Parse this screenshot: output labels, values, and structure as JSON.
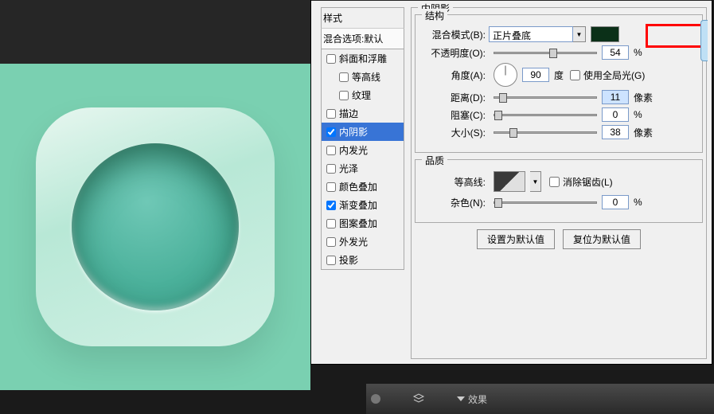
{
  "styles_panel": {
    "header": "样式",
    "default_row": "混合选项:默认",
    "items": [
      {
        "label": "斜面和浮雕",
        "checked": false,
        "indent": false
      },
      {
        "label": "等高线",
        "checked": false,
        "indent": true
      },
      {
        "label": "纹理",
        "checked": false,
        "indent": true
      },
      {
        "label": "描边",
        "checked": false,
        "indent": false
      },
      {
        "label": "内阴影",
        "checked": true,
        "indent": false,
        "selected": true
      },
      {
        "label": "内发光",
        "checked": false,
        "indent": false
      },
      {
        "label": "光泽",
        "checked": false,
        "indent": false
      },
      {
        "label": "颜色叠加",
        "checked": false,
        "indent": false
      },
      {
        "label": "渐变叠加",
        "checked": true,
        "indent": false
      },
      {
        "label": "图案叠加",
        "checked": false,
        "indent": false
      },
      {
        "label": "外发光",
        "checked": false,
        "indent": false
      },
      {
        "label": "投影",
        "checked": false,
        "indent": false
      }
    ]
  },
  "panel_title": "内阴影",
  "structure": {
    "title": "结构",
    "blend_mode_label": "混合模式(B):",
    "blend_mode_value": "正片叠底",
    "color": "#0b3018",
    "opacity_label": "不透明度(O):",
    "opacity_value": "54",
    "opacity_unit": "%",
    "angle_label": "角度(A):",
    "angle_value": "90",
    "angle_unit": "度",
    "global_light_label": "使用全局光(G)",
    "distance_label": "距离(D):",
    "distance_value": "11",
    "distance_unit": "像素",
    "choke_label": "阻塞(C):",
    "choke_value": "0",
    "choke_unit": "%",
    "size_label": "大小(S):",
    "size_value": "38",
    "size_unit": "像素"
  },
  "quality": {
    "title": "品质",
    "contour_label": "等高线:",
    "antialias_label": "消除锯齿(L)",
    "noise_label": "杂色(N):",
    "noise_value": "0",
    "noise_unit": "%"
  },
  "buttons": {
    "make_default": "设置为默认值",
    "reset_default": "复位为默认值"
  },
  "bottombar": {
    "effects": "效果"
  }
}
